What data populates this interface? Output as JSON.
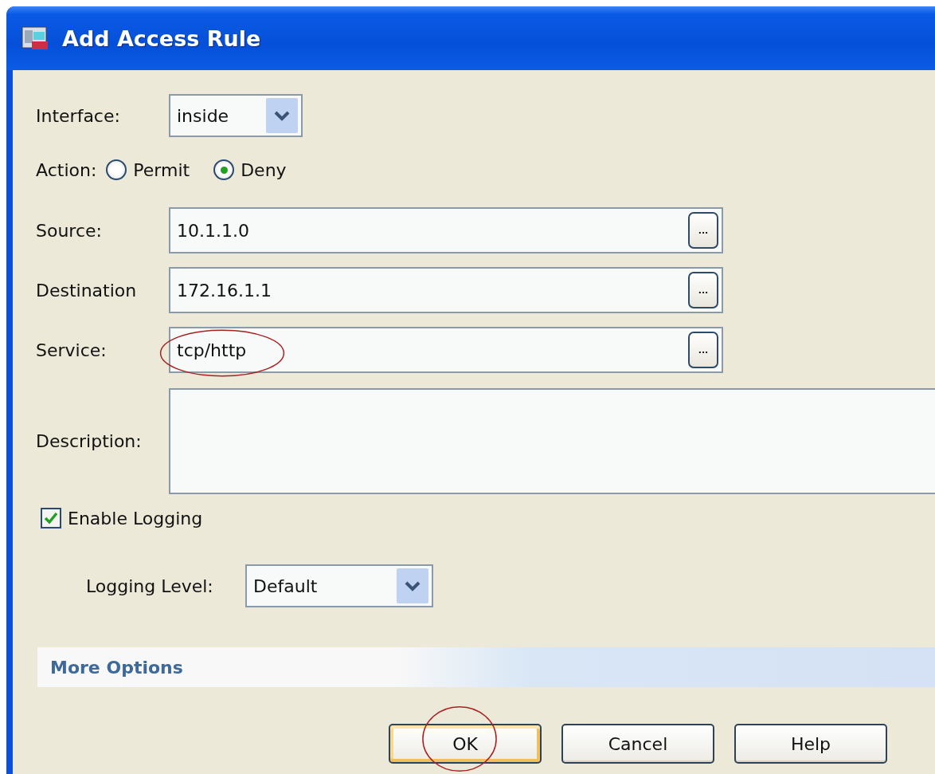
{
  "window": {
    "title": "Add Access Rule"
  },
  "interface": {
    "label": "Interface:",
    "value": "inside"
  },
  "action": {
    "label": "Action:",
    "options": [
      {
        "label": "Permit",
        "selected": false
      },
      {
        "label": "Deny",
        "selected": true
      }
    ]
  },
  "fields": [
    {
      "label": "Source:",
      "value": "10.1.1.0",
      "browse": "...",
      "highlighted": false
    },
    {
      "label": "Destination",
      "value": "172.16.1.1",
      "browse": "...",
      "highlighted": false
    },
    {
      "label": "Service:",
      "value": "tcp/http",
      "browse": "...",
      "highlighted": true
    }
  ],
  "description": {
    "label": "Description:"
  },
  "enable_logging": {
    "label": "Enable Logging",
    "checked": true
  },
  "logging_level": {
    "label": "Logging Level:",
    "value": "Default"
  },
  "more_options": {
    "label": "More Options"
  },
  "buttons": [
    {
      "label": "OK",
      "default": true,
      "highlighted": true
    },
    {
      "label": "Cancel",
      "default": false,
      "highlighted": false
    },
    {
      "label": "Help",
      "default": false,
      "highlighted": false
    }
  ]
}
